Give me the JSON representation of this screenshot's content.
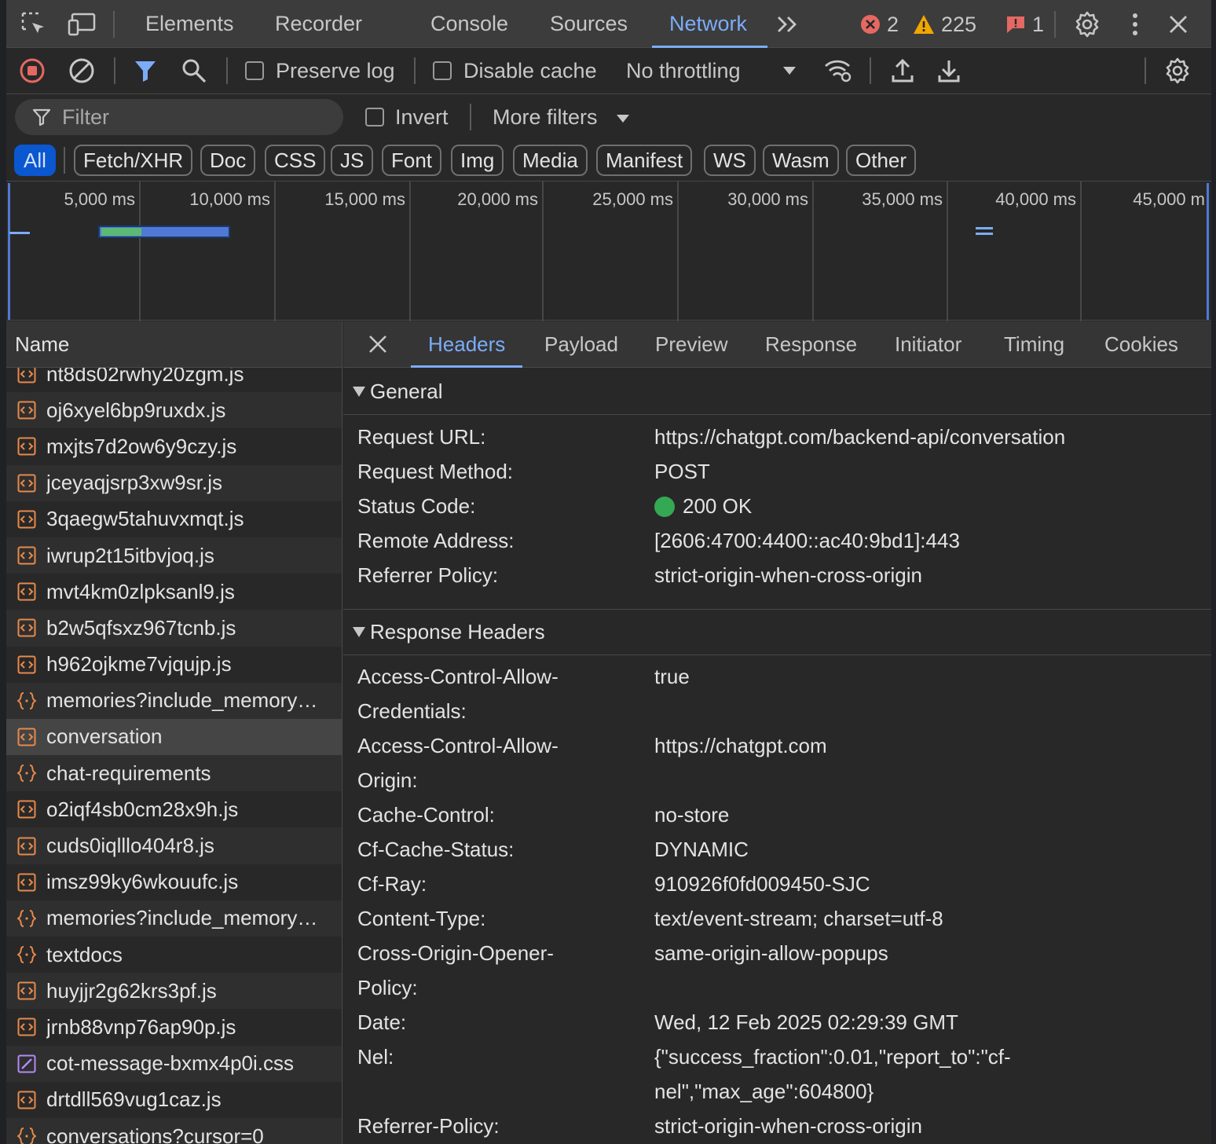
{
  "devtools": {
    "tabs": [
      "Elements",
      "Recorder",
      "Console",
      "Sources",
      "Network"
    ],
    "active_tab": "Network",
    "more_tabs": "»",
    "errors": "2",
    "warnings": "225",
    "issues": "1"
  },
  "toolbar": {
    "preserve_log": "Preserve log",
    "disable_cache": "Disable cache",
    "throttling": "No throttling"
  },
  "filter": {
    "placeholder": "Filter",
    "invert": "Invert",
    "more_filters": "More filters"
  },
  "type_filters": [
    "All",
    "Fetch/XHR",
    "Doc",
    "CSS",
    "JS",
    "Font",
    "Img",
    "Media",
    "Manifest",
    "WS",
    "Wasm",
    "Other"
  ],
  "overview": {
    "ticks": [
      "5,000 ms",
      "10,000 ms",
      "15,000 ms",
      "20,000 ms",
      "25,000 ms",
      "30,000 ms",
      "35,000 ms",
      "40,000 ms",
      "45,000 m"
    ]
  },
  "requests": {
    "header": "Name",
    "rows": [
      {
        "name": "nt8ds02rwhy20zgm.js",
        "type": "js"
      },
      {
        "name": "oj6xyel6bp9ruxdx.js",
        "type": "js"
      },
      {
        "name": "mxjts7d2ow6y9czy.js",
        "type": "js"
      },
      {
        "name": "jceyaqjsrp3xw9sr.js",
        "type": "js"
      },
      {
        "name": "3qaegw5tahuvxmqt.js",
        "type": "js"
      },
      {
        "name": "iwrup2t15itbvjoq.js",
        "type": "js"
      },
      {
        "name": "mvt4km0zlpksanl9.js",
        "type": "js"
      },
      {
        "name": "b2w5qfsxz967tcnb.js",
        "type": "js"
      },
      {
        "name": "h962ojkme7vjqujp.js",
        "type": "js"
      },
      {
        "name": "memories?include_memory…",
        "type": "fetch"
      },
      {
        "name": "conversation",
        "type": "js",
        "selected": true
      },
      {
        "name": "chat-requirements",
        "type": "fetch"
      },
      {
        "name": "o2iqf4sb0cm28x9h.js",
        "type": "js"
      },
      {
        "name": "cuds0iqlllo404r8.js",
        "type": "js"
      },
      {
        "name": "imsz99ky6wkouufc.js",
        "type": "js"
      },
      {
        "name": "memories?include_memory…",
        "type": "fetch"
      },
      {
        "name": "textdocs",
        "type": "fetch"
      },
      {
        "name": "huyjjr2g62krs3pf.js",
        "type": "js"
      },
      {
        "name": "jrnb88vnp76ap90p.js",
        "type": "js"
      },
      {
        "name": "cot-message-bxmx4p0i.css",
        "type": "css"
      },
      {
        "name": "drtdll569vug1caz.js",
        "type": "js"
      },
      {
        "name": "conversations?cursor=0",
        "type": "fetch"
      }
    ]
  },
  "detail": {
    "tabs": [
      "Headers",
      "Payload",
      "Preview",
      "Response",
      "Initiator",
      "Timing",
      "Cookies"
    ],
    "active_tab": "Headers",
    "general": {
      "title": "General",
      "request_url_k": "Request URL:",
      "request_url_v": "https://chatgpt.com/backend-api/conversation",
      "method_k": "Request Method:",
      "method_v": "POST",
      "status_k": "Status Code:",
      "status_v": "200 OK",
      "remote_k": "Remote Address:",
      "remote_v": "[2606:4700:4400::ac40:9bd1]:443",
      "referrer_k": "Referrer Policy:",
      "referrer_v": "strict-origin-when-cross-origin"
    },
    "response_headers": {
      "title": "Response Headers",
      "acac_k1": "Access-Control-Allow-",
      "acac_k2": "Credentials:",
      "acac_v": "true",
      "acao_k1": "Access-Control-Allow-",
      "acao_k2": "Origin:",
      "acao_v": "https://chatgpt.com",
      "cc_k": "Cache-Control:",
      "cc_v": "no-store",
      "cfcs_k": "Cf-Cache-Status:",
      "cfcs_v": "DYNAMIC",
      "cfray_k": "Cf-Ray:",
      "cfray_v": "910926f0fd009450-SJC",
      "ct_k": "Content-Type:",
      "ct_v": "text/event-stream; charset=utf-8",
      "coop_k1": "Cross-Origin-Opener-",
      "coop_k2": "Policy:",
      "coop_v": "same-origin-allow-popups",
      "date_k": "Date:",
      "date_v": "Wed, 12 Feb 2025 02:29:39 GMT",
      "nel_k": "Nel:",
      "nel_v1": "{\"success_fraction\":0.01,\"report_to\":\"cf-",
      "nel_v2": "nel\",\"max_age\":604800}",
      "rp_k": "Referrer-Policy:",
      "rp_v": "strict-origin-when-cross-origin"
    }
  },
  "colors": {
    "accent": "#7cacf8",
    "selected_chip": "#0b57d0",
    "js_icon": "#e8894a",
    "css_icon": "#b48af5",
    "status_ok": "#34a853",
    "error": "#e46962",
    "warning": "#f2a600"
  }
}
